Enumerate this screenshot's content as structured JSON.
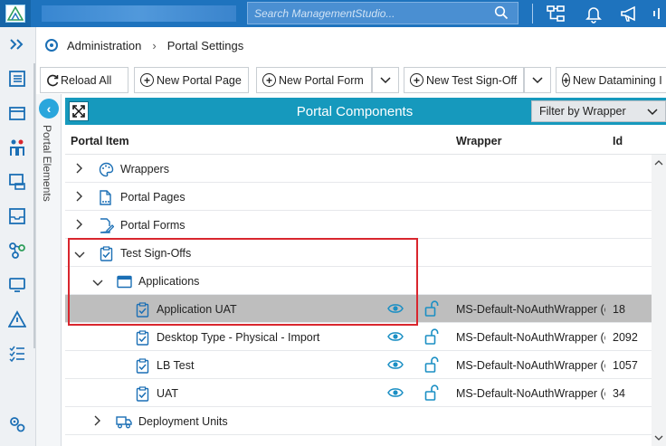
{
  "header": {
    "search_placeholder": "Search ManagementStudio..."
  },
  "breadcrumb": {
    "root": "Administration",
    "current": "Portal Settings"
  },
  "toolbar": {
    "reload": "Reload All",
    "new_portal_page": "New Portal Page",
    "new_portal_form": "New Portal Form",
    "new_test_signoff": "New Test Sign-Off",
    "new_datamining": "New Datamining I"
  },
  "sidebar": {
    "portal_elements": "Portal Elements"
  },
  "panel": {
    "title": "Portal Components",
    "filter": "Filter by Wrapper"
  },
  "columns": {
    "item": "Portal Item",
    "wrapper": "Wrapper",
    "id": "Id"
  },
  "tree": {
    "wrappers": "Wrappers",
    "portal_pages": "Portal Pages",
    "portal_forms": "Portal Forms",
    "test_signoffs": "Test Sign-Offs",
    "applications": "Applications",
    "deployment_units": "Deployment Units",
    "items": [
      {
        "label": "Application UAT",
        "wrapper": "MS-Default-NoAuthWrapper (e",
        "id": "18"
      },
      {
        "label": "Desktop Type - Physical - Import",
        "wrapper": "MS-Default-NoAuthWrapper (e",
        "id": "2092"
      },
      {
        "label": "LB Test",
        "wrapper": "MS-Default-NoAuthWrapper (e",
        "id": "1057"
      },
      {
        "label": "UAT",
        "wrapper": "MS-Default-NoAuthWrapper (e",
        "id": "34"
      }
    ]
  },
  "colors": {
    "topbar": "#1e73be",
    "panel_header": "#1699bd",
    "highlight": "#d9262e",
    "icon_blue": "#1b6fb5",
    "selected_row": "#bebebe"
  }
}
